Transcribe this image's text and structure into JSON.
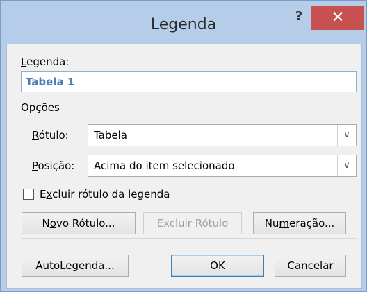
{
  "window": {
    "title": "Legenda",
    "help_glyph": "?",
    "close_glyph": "✕"
  },
  "caption": {
    "label_pre": "",
    "label_u": "L",
    "label_post": "egenda:",
    "value": "Tabela 1"
  },
  "options": {
    "group_title": "Opções",
    "rotulo": {
      "label_u": "R",
      "label_post": "ótulo:",
      "selected": "Tabela"
    },
    "posicao": {
      "label_u": "P",
      "label_post": "osição:",
      "selected": "Acima do item selecionado"
    },
    "exclude_checkbox": {
      "label_pre": "E",
      "label_u": "x",
      "label_post": "cluir rótulo da legenda",
      "checked": false
    }
  },
  "buttons": {
    "novo_rotulo": {
      "pre": "N",
      "u": "o",
      "post": "vo Rótulo..."
    },
    "excluir_rotulo": "Excluir Rótulo",
    "numeracao": {
      "pre": "Nu",
      "u": "m",
      "post": "eração..."
    },
    "autolegenda": {
      "pre": "A",
      "u": "u",
      "post": "toLegenda..."
    },
    "ok": "OK",
    "cancelar": "Cancelar"
  },
  "icons": {
    "dropdown": "chevron-down-icon",
    "help": "help-icon",
    "close": "close-icon"
  }
}
